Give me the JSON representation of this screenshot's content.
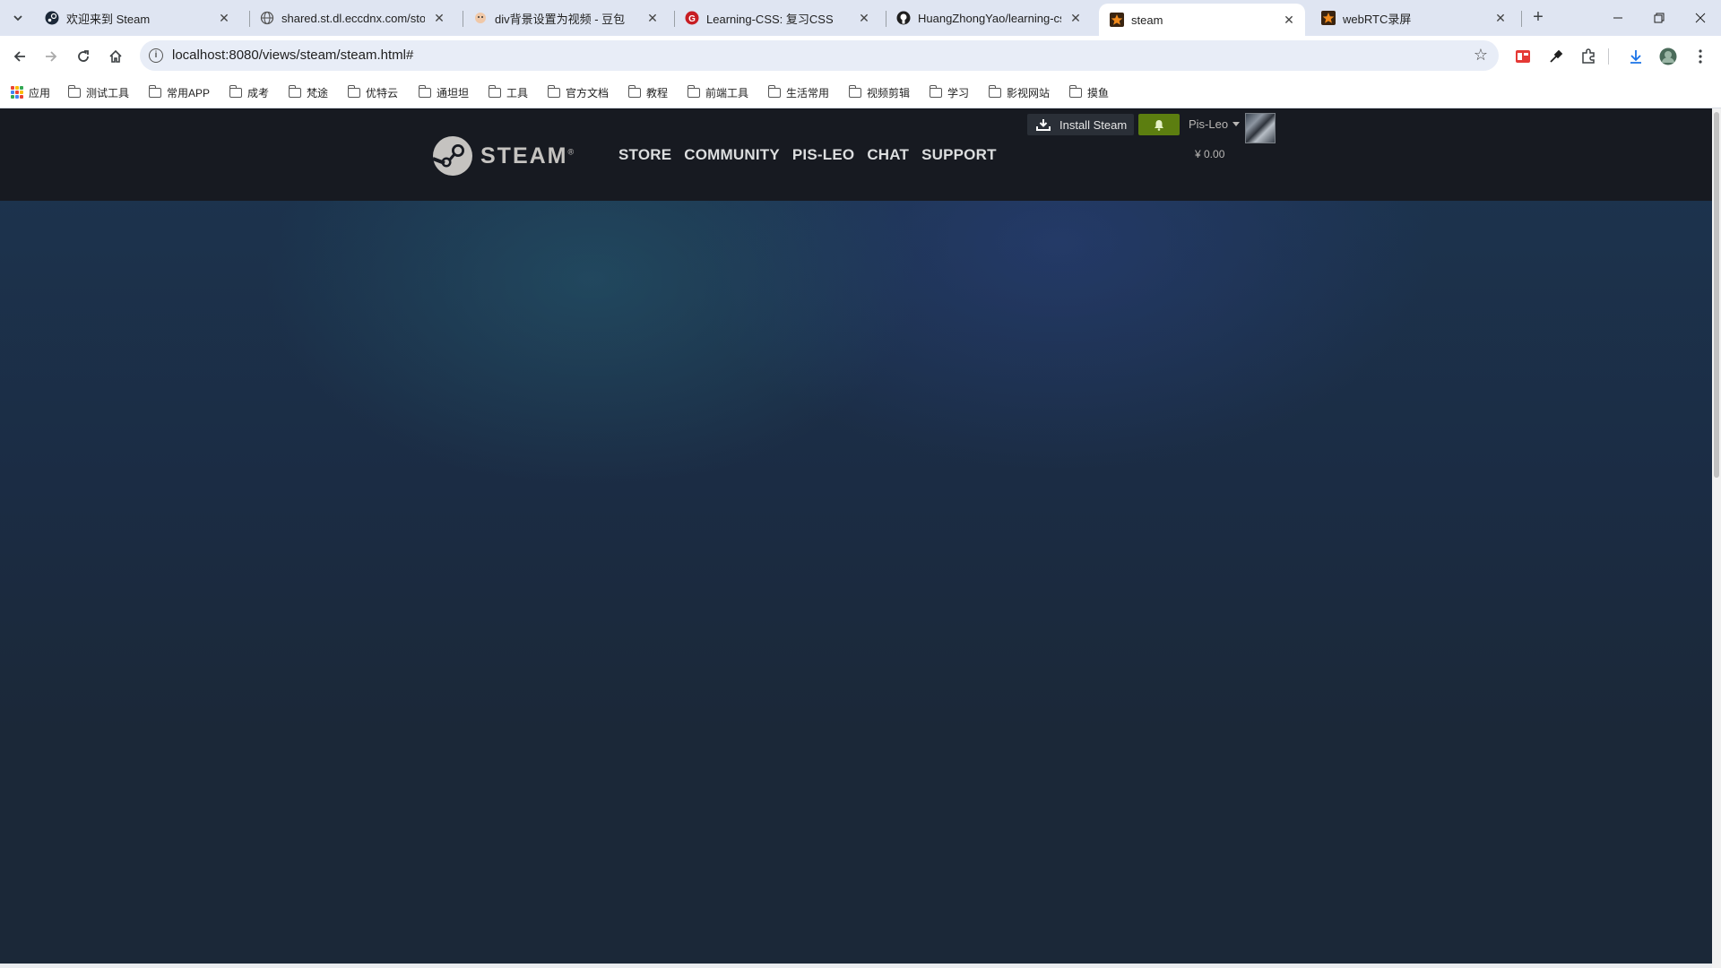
{
  "browser": {
    "tabs": [
      {
        "title": "欢迎来到 Steam",
        "favicon": "steam-logo-icon",
        "active": false
      },
      {
        "title": "shared.st.dl.eccdnx.com/store",
        "favicon": "globe-icon",
        "active": false
      },
      {
        "title": "div背景设置为视频 - 豆包",
        "favicon": "doubao-icon",
        "active": false
      },
      {
        "title": "Learning-CSS: 复习CSS",
        "favicon": "gitee-icon",
        "active": false
      },
      {
        "title": "HuangZhongYao/learning-css",
        "favicon": "github-icon",
        "active": false
      },
      {
        "title": "steam",
        "favicon": "star-icon",
        "active": true
      },
      {
        "title": "webRTC录屏",
        "favicon": "star-icon",
        "active": false
      }
    ],
    "url": "localhost:8080/views/steam/steam.html#",
    "bookmarks": [
      "应用",
      "测试工具",
      "常用APP",
      "成考",
      "梵途",
      "优特云",
      "通坦坦",
      "工具",
      "官方文档",
      "教程",
      "前端工具",
      "生活常用",
      "视频剪辑",
      "学习",
      "影视网站",
      "摸鱼"
    ]
  },
  "steam": {
    "logo_text": "STEAM",
    "logo_mark": "®",
    "nav": [
      "STORE",
      "COMMUNITY",
      "PIS-LEO",
      "CHAT",
      "SUPPORT"
    ],
    "install_label": "Install Steam",
    "username": "Pis-Leo",
    "wallet": "¥ 0.00",
    "colors": {
      "header_bg": "#171a21",
      "page_bg": "#1b2838",
      "notification_green": "#5c7e10",
      "nav_text": "#dcdedf"
    }
  }
}
